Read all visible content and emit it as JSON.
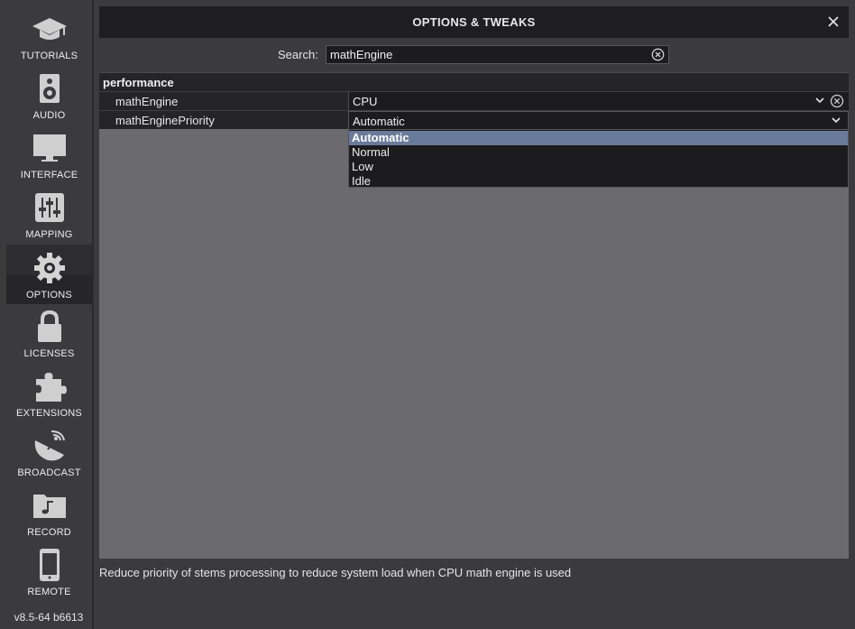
{
  "sidebar": {
    "items": [
      {
        "label": "TUTORIALS",
        "icon": "graduation-cap-icon"
      },
      {
        "label": "AUDIO",
        "icon": "speaker-icon"
      },
      {
        "label": "INTERFACE",
        "icon": "monitor-icon"
      },
      {
        "label": "MAPPING",
        "icon": "sliders-icon"
      },
      {
        "label": "OPTIONS",
        "icon": "gear-icon",
        "active": true
      },
      {
        "label": "LICENSES",
        "icon": "lock-icon"
      },
      {
        "label": "EXTENSIONS",
        "icon": "puzzle-icon"
      },
      {
        "label": "BROADCAST",
        "icon": "satellite-dish-icon"
      },
      {
        "label": "RECORD",
        "icon": "music-folder-icon"
      },
      {
        "label": "REMOTE",
        "icon": "phone-icon"
      }
    ],
    "version": "v8.5-64 b6613"
  },
  "window": {
    "title": "OPTIONS & TWEAKS"
  },
  "search": {
    "label": "Search:",
    "value": "mathEngine"
  },
  "settings": {
    "section": "performance",
    "rows": [
      {
        "name": "mathEngine",
        "value": "CPU"
      },
      {
        "name": "mathEnginePriority",
        "value": "Automatic"
      }
    ]
  },
  "dropdown": {
    "options": [
      "Automatic",
      "Normal",
      "Low",
      "Idle"
    ],
    "selected": "Automatic"
  },
  "footer": {
    "description": "Reduce priority of stems processing to reduce system load when CPU math engine is used"
  },
  "colors": {
    "panel_bg": "#6b6b6f",
    "selected_option": "#6a7a9a",
    "dark_field": "#1c1c1f"
  }
}
